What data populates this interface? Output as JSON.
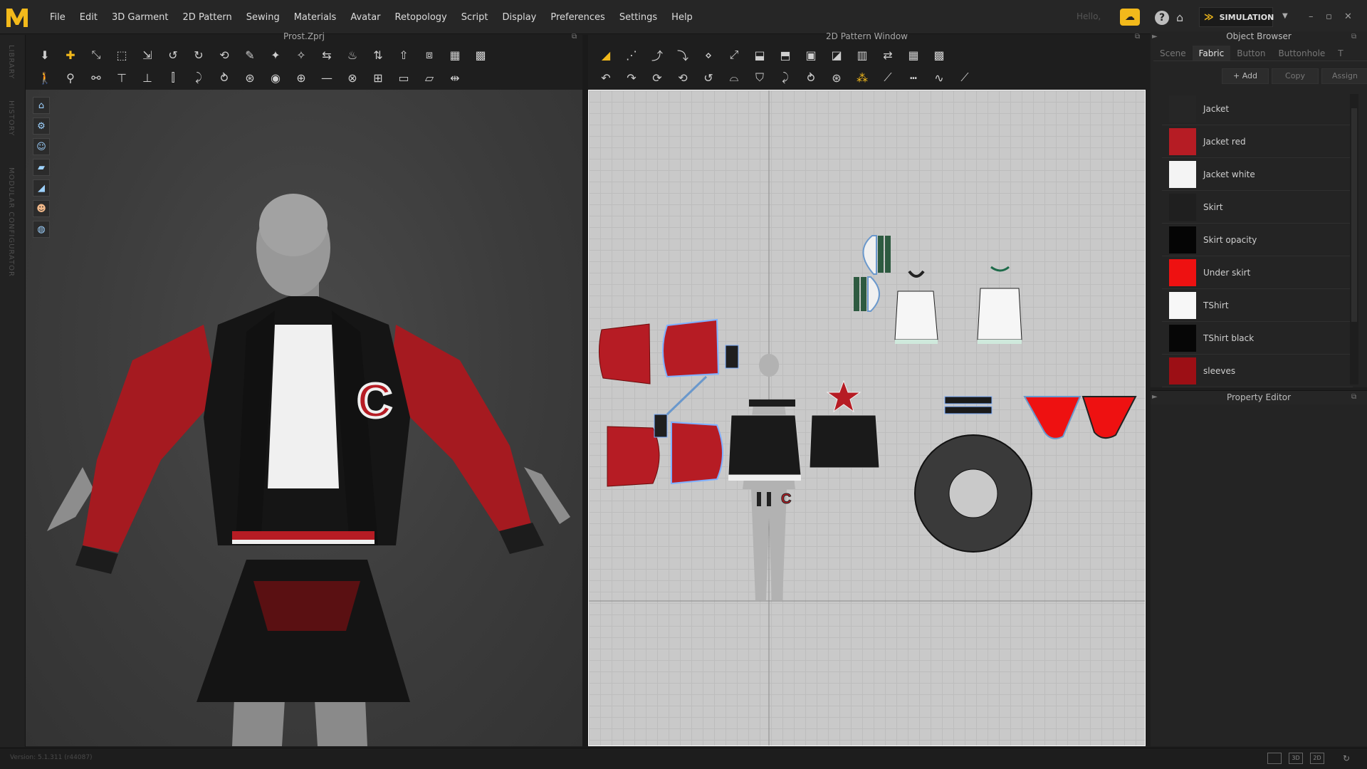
{
  "app": {
    "menu": [
      "File",
      "Edit",
      "3D Garment",
      "2D Pattern",
      "Sewing",
      "Materials",
      "Avatar",
      "Retopology",
      "Script",
      "Display",
      "Preferences",
      "Settings",
      "Help"
    ],
    "greeting": "Hello,",
    "mode_label": "SIMULATION",
    "logo_letter": "M",
    "cloud_glyph": "☁",
    "help_glyph": "?",
    "shop_glyph": "⌂",
    "window_buttons": [
      "–",
      "▫",
      "✕"
    ]
  },
  "left_rail": [
    "LIBRARY",
    "HISTORY",
    "MODULAR CONFIGURATOR"
  ],
  "viewport3d": {
    "title": "Prost.Zprj",
    "letter_patch": "C"
  },
  "pattern2d": {
    "title": "2D Pattern Window"
  },
  "object_browser": {
    "title": "Object Browser",
    "tabs": [
      "Scene",
      "Fabric",
      "Button",
      "Buttonhole",
      "T"
    ],
    "active_tab": "Fabric",
    "actions": [
      "+  Add",
      "Copy",
      "Assign"
    ],
    "fabrics": [
      {
        "name": "Jacket",
        "color": "#262626"
      },
      {
        "name": "Jacket red",
        "color": "#b61c24"
      },
      {
        "name": "Jacket white",
        "color": "#f4f4f4"
      },
      {
        "name": "Skirt",
        "color": "#1f1f1f"
      },
      {
        "name": "Skirt opacity",
        "color": "#050505"
      },
      {
        "name": "Under skirt",
        "color": "#ee1111"
      },
      {
        "name": "TShirt",
        "color": "#f7f7f7"
      },
      {
        "name": "TShirt black",
        "color": "#060606"
      },
      {
        "name": "sleeves",
        "color": "#9c0f15"
      }
    ]
  },
  "property_editor": {
    "title": "Property Editor"
  },
  "status": {
    "version": "Version: 5.1.311 (r44087)",
    "view_buttons": [
      "",
      "3D",
      "2D"
    ]
  },
  "colors": {
    "accent": "#f2b91b",
    "jacket_red": "#b61c24",
    "pattern_bg": "#c9c9c9"
  }
}
